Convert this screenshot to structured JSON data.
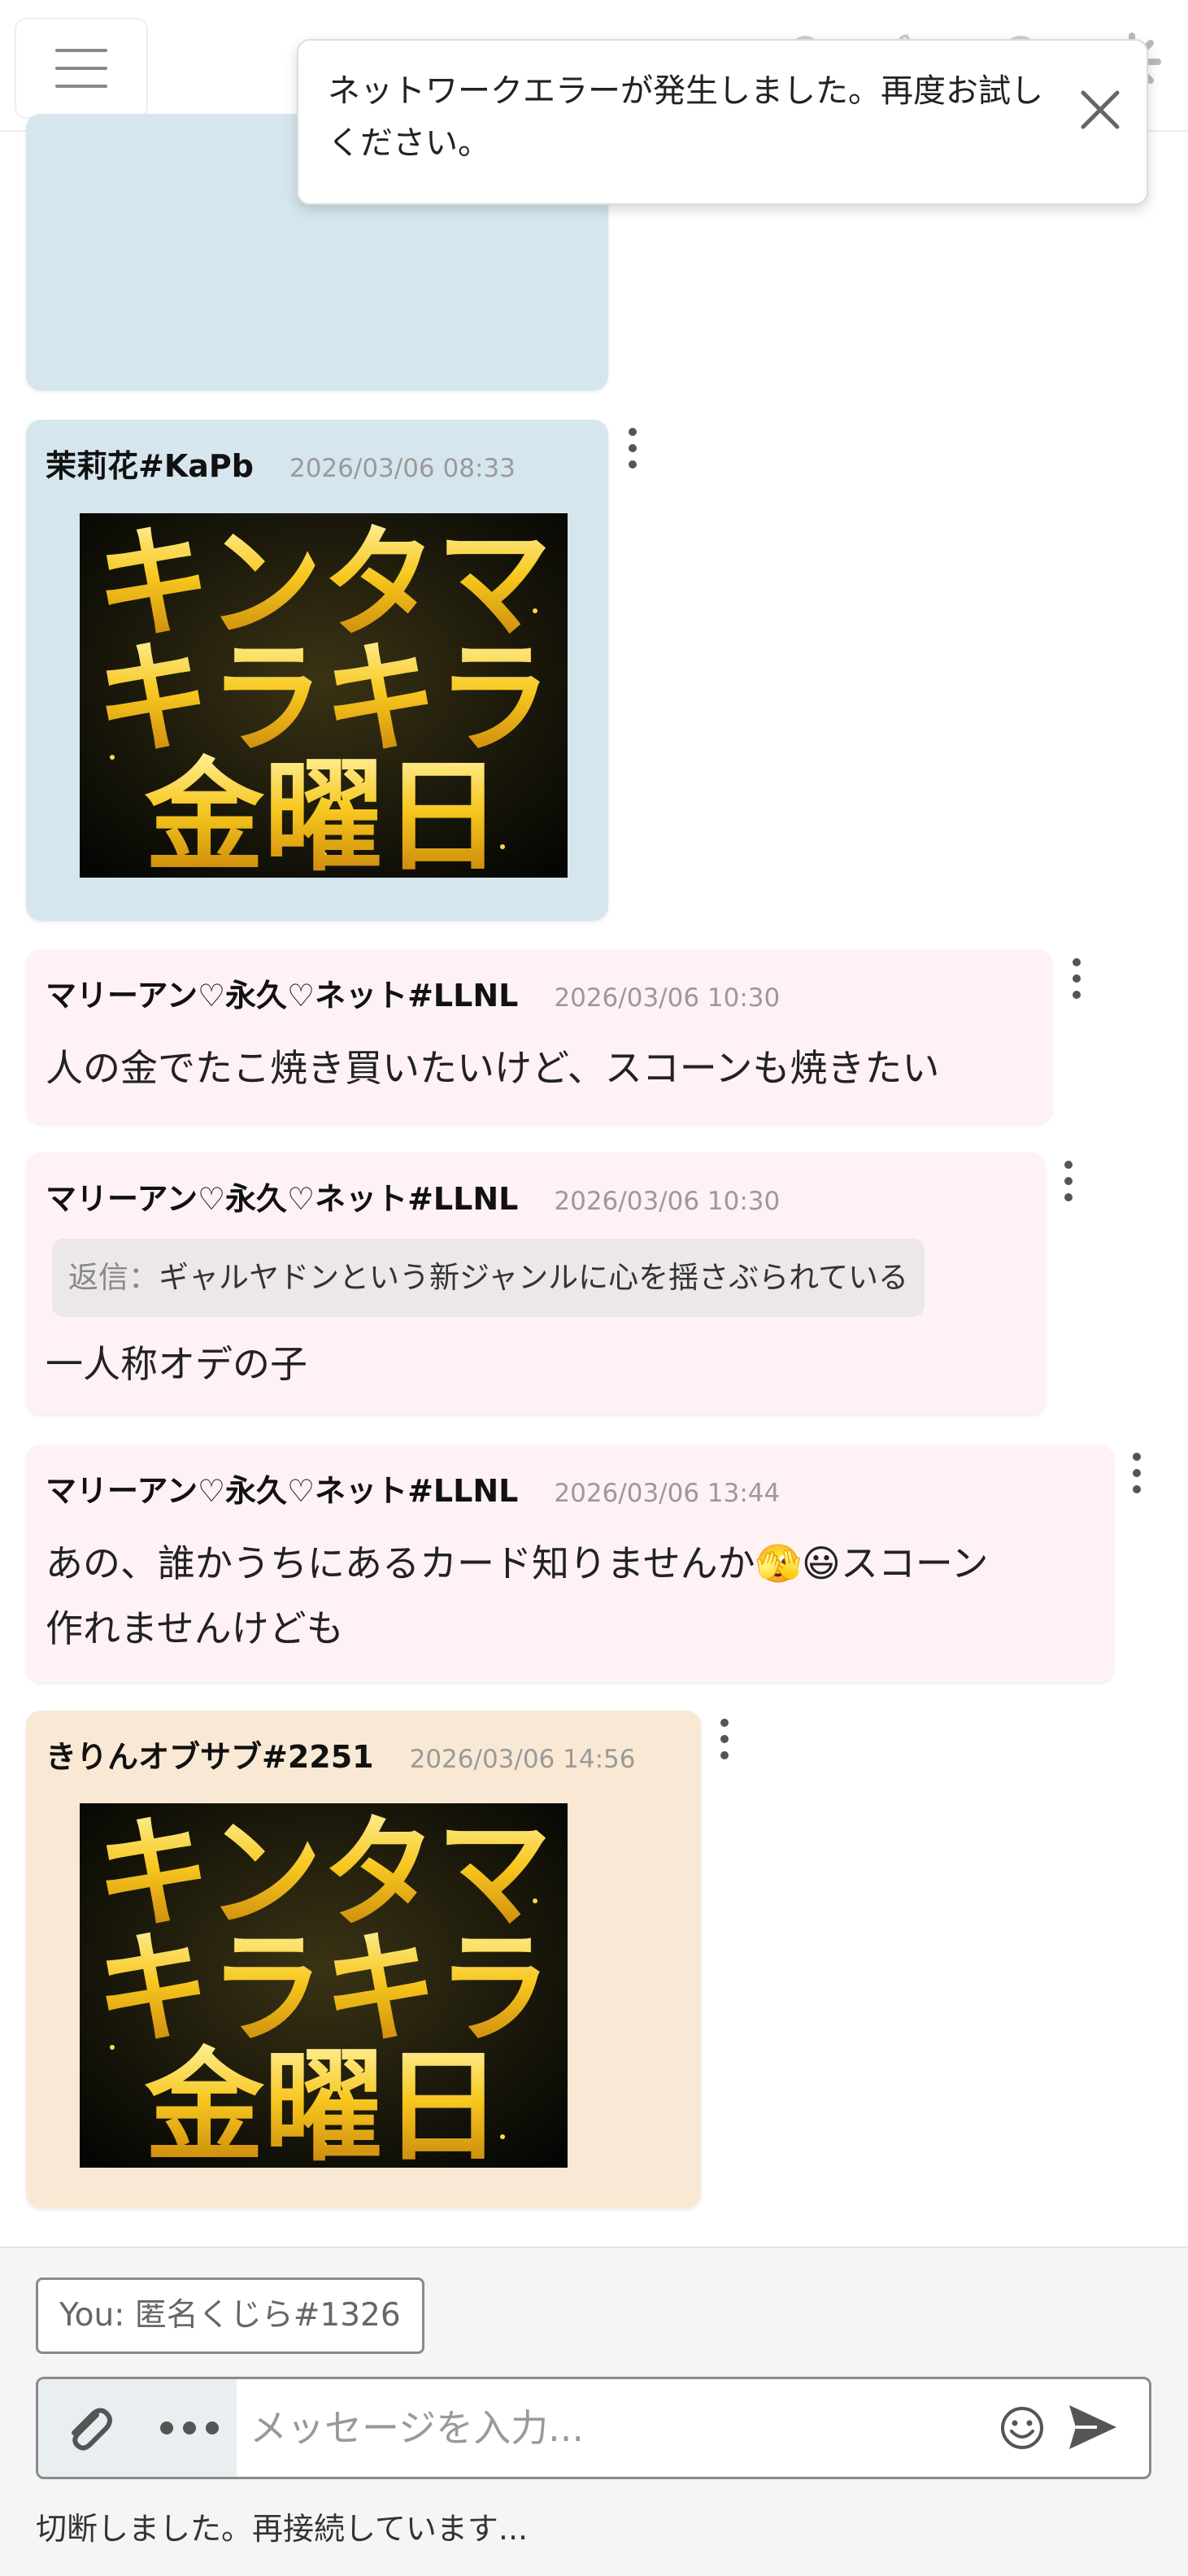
{
  "toast": {
    "message": "ネットワークエラーが発生しました。再度お試しください。"
  },
  "messages": [
    {
      "author": "茉莉花#KaPb",
      "timestamp": "2026/03/06 08:33",
      "image_text": [
        "キンタマ",
        "キラキラ",
        "金曜日"
      ]
    },
    {
      "author": "マリーアン♡永久♡ネット#LLNL",
      "timestamp": "2026/03/06 10:30",
      "text": "人の金でたこ焼き買いたいけど、スコーンも焼きたい"
    },
    {
      "author": "マリーアン♡永久♡ネット#LLNL",
      "timestamp": "2026/03/06 10:30",
      "reply_label": "返信：",
      "reply_text": "ギャルヤドンという新ジャンルに心を揺さぶられている",
      "text": "一人称オデの子"
    },
    {
      "author": "マリーアン♡永久♡ネット#LLNL",
      "timestamp": "2026/03/06 13:44",
      "text_line1": "あの、誰かうちにあるカード知りませんか🫣😃スコーン",
      "text_line2": "作れませんけども"
    },
    {
      "author": "きりんオブサブ#2251",
      "timestamp": "2026/03/06 14:56",
      "image_text": [
        "キンタマ",
        "キラキラ",
        "金曜日"
      ]
    }
  ],
  "composer": {
    "identity": "You: 匿名くじら#1326",
    "placeholder": "メッセージを入力...",
    "status": "切断しました。再接続しています..."
  },
  "icons": {
    "menu": "hamburger-menu-icon",
    "settings": "gear-icon",
    "close": "close-icon",
    "attach": "paperclip-icon",
    "more": "more-horizontal-icon",
    "emoji": "emoji-smile-icon",
    "send": "send-icon",
    "message_menu": "kebab-menu-icon"
  },
  "colors": {
    "bubble_blue": "#d6e6ee",
    "bubble_pink": "#fff2f5",
    "bubble_tan": "#f9e9d4",
    "image_gold": "#f4c21c"
  }
}
